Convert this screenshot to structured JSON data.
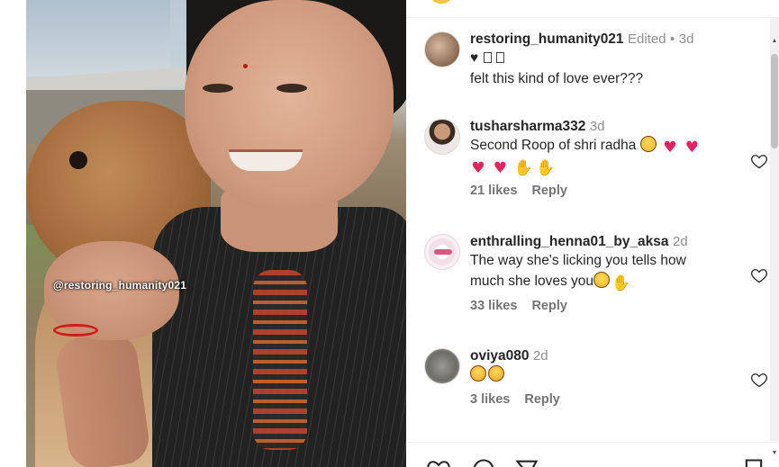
{
  "post": {
    "watermark": "@restoring_humanity021"
  },
  "comments": [
    {
      "username": "restoring_humanity021",
      "edited": "Edited",
      "separator": "•",
      "time": "3d",
      "line1": "♥",
      "line2": "felt this kind of love ever???"
    },
    {
      "username": "tusharsharma332",
      "time": "3d",
      "text": "Second Roop of shri radha",
      "likes": "21 likes",
      "reply": "Reply"
    },
    {
      "username": "enthralling_henna01_by_aksa",
      "time": "2d",
      "text1": "The way she's licking you tells how",
      "text2": "much she loves you",
      "likes": "33 likes",
      "reply": "Reply"
    },
    {
      "username": "oviya080",
      "time": "2d",
      "likes": "3 likes",
      "reply": "Reply"
    }
  ],
  "icons": {
    "like": "heart-icon",
    "comment": "comment-icon",
    "share": "share-icon",
    "save": "bookmark-icon"
  },
  "colors": {
    "text": "#262626",
    "muted": "#737373",
    "heart_emoji": "#e0245e"
  }
}
